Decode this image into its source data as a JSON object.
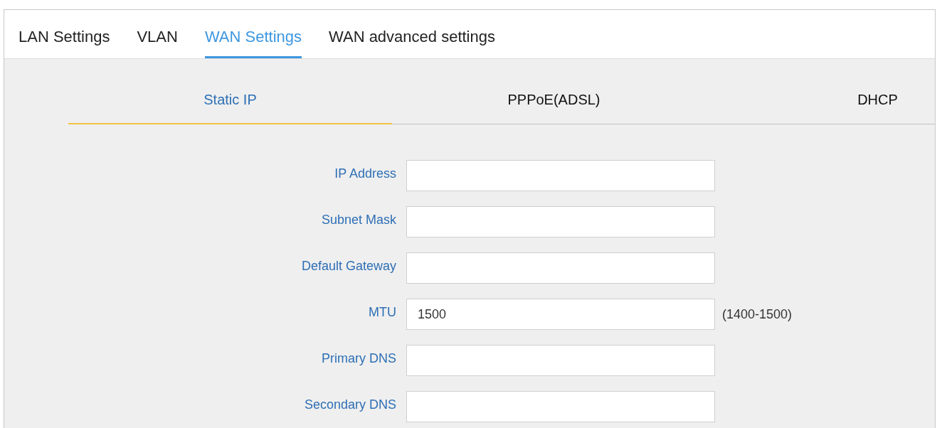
{
  "tabs": [
    {
      "label": "LAN Settings",
      "selected": false
    },
    {
      "label": "VLAN",
      "selected": false
    },
    {
      "label": "WAN Settings",
      "selected": true
    },
    {
      "label": "WAN advanced settings",
      "selected": false
    }
  ],
  "connection_types": [
    {
      "label": "Static IP",
      "selected": true
    },
    {
      "label": "PPPoE(ADSL)",
      "selected": false
    },
    {
      "label": "DHCP",
      "selected": false
    }
  ],
  "fields": [
    {
      "label": "IP Address"
    },
    {
      "label": "Subnet Mask"
    },
    {
      "label": "Default Gateway"
    },
    {
      "label": "MTU",
      "value": "1500",
      "hint": "(1400-1500)"
    },
    {
      "label": "Primary DNS"
    },
    {
      "label": "Secondary DNS"
    }
  ]
}
